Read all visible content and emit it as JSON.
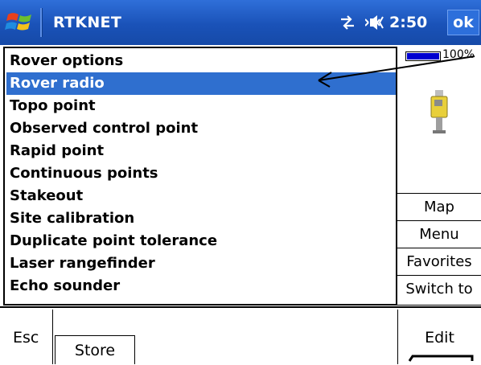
{
  "titlebar": {
    "app_title": "RTKNET",
    "clock": "2:50",
    "ok_label": "ok",
    "icons": [
      "windows-logo",
      "connectivity-icon",
      "volume-icon"
    ]
  },
  "list": {
    "items": [
      {
        "label": "Rover options"
      },
      {
        "label": "Rover radio",
        "selected": true
      },
      {
        "label": "Topo point"
      },
      {
        "label": "Observed control point"
      },
      {
        "label": "Rapid point"
      },
      {
        "label": "Continuous points"
      },
      {
        "label": "Stakeout"
      },
      {
        "label": "Site calibration"
      },
      {
        "label": "Duplicate point tolerance"
      },
      {
        "label": "Laser rangefinder"
      },
      {
        "label": "Echo sounder"
      }
    ]
  },
  "status": {
    "battery_text": "100%",
    "battery_level": 1.0,
    "instrument_icon": "gnss-receiver-icon"
  },
  "side_menu": {
    "map": "Map",
    "menu": "Menu",
    "favorites": "Favorites",
    "switch_to": "Switch to"
  },
  "bottom": {
    "esc": "Esc",
    "store": "Store",
    "edit": "Edit"
  },
  "colors": {
    "titlebar": "#1a52b8",
    "selection": "#2f6fcf",
    "battery_fill": "#0000d0"
  }
}
